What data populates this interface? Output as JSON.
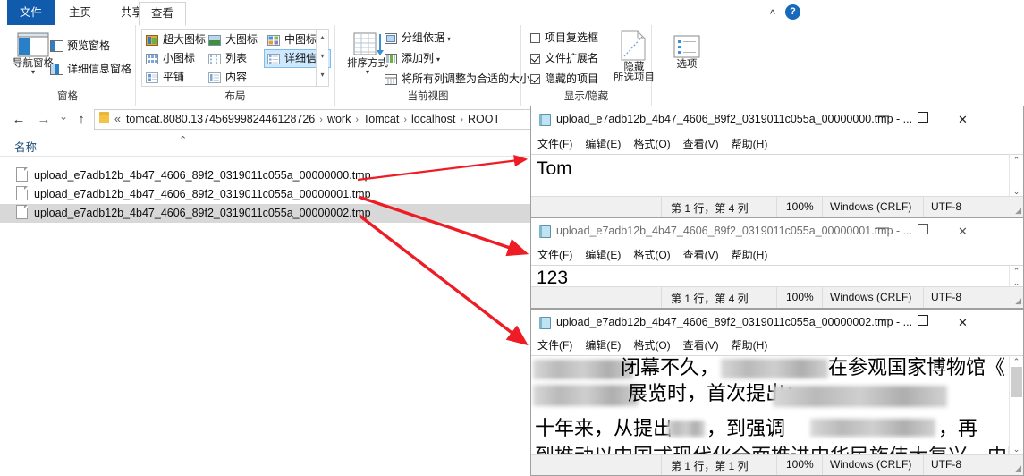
{
  "explorer": {
    "tabs": [
      {
        "label": "文件",
        "active": false,
        "file": true
      },
      {
        "label": "主页",
        "active": false
      },
      {
        "label": "共享",
        "active": false
      },
      {
        "label": "查看",
        "active": true
      }
    ],
    "help_icon": "?",
    "collapse_icon": "chevron-up-icon",
    "ribbon_groups": [
      {
        "name": "窗格",
        "big_button": {
          "label": "导航窗格",
          "caret": "▾"
        },
        "items": [
          {
            "label": "预览窗格"
          },
          {
            "label": "详细信息窗格"
          }
        ]
      },
      {
        "name": "布局",
        "items": [
          {
            "label": "超大图标"
          },
          {
            "label": "大图标"
          },
          {
            "label": "中图标"
          },
          {
            "label": "小图标"
          },
          {
            "label": "列表"
          },
          {
            "label": "详细信息",
            "selected": true
          },
          {
            "label": "平铺"
          },
          {
            "label": "内容"
          }
        ],
        "scroll": [
          "▴",
          "▾",
          "▾"
        ]
      },
      {
        "name": "当前视图",
        "big_button": {
          "label": "排序方式",
          "caret": "▾"
        },
        "items": [
          {
            "label": "分组依据",
            "caret": "▾"
          },
          {
            "label": "添加列",
            "caret": "▾"
          },
          {
            "label": "将所有列调整为合适的大小"
          }
        ]
      },
      {
        "name": "显示/隐藏",
        "checkboxes": [
          {
            "label": "项目复选框",
            "checked": false
          },
          {
            "label": "文件扩展名",
            "checked": true
          },
          {
            "label": "隐藏的项目",
            "checked": true
          }
        ],
        "big_button": {
          "label_line1": "隐藏",
          "label_line2": "所选项目"
        }
      },
      {
        "name": "",
        "big_button": {
          "label": "选项"
        }
      }
    ],
    "nav": {
      "back": "←",
      "forward": "→",
      "recent": "⌄",
      "up": "↑"
    },
    "address": {
      "overflow": "«",
      "crumbs": [
        "tomcat.8080.13745699982446128726",
        "work",
        "Tomcat",
        "localhost",
        "ROOT"
      ],
      "separator": "›"
    },
    "column_header": {
      "name": "名称",
      "sort_arrow": "⌃"
    },
    "files": [
      {
        "name": "upload_e7adb12b_4b47_4606_89f2_0319011c055a_00000000.tmp",
        "selected": false
      },
      {
        "name": "upload_e7adb12b_4b47_4606_89f2_0319011c055a_00000001.tmp",
        "selected": false
      },
      {
        "name": "upload_e7adb12b_4b47_4606_89f2_0319011c055a_00000002.tmp",
        "selected": true
      }
    ]
  },
  "notepads": [
    {
      "title": "upload_e7adb12b_4b47_4606_89f2_0319011c055a_00000000.tmp - ...",
      "active": true,
      "menu": [
        "文件(F)",
        "编辑(E)",
        "格式(O)",
        "查看(V)",
        "帮助(H)"
      ],
      "content": "Tom",
      "controls": {
        "minimize": "—",
        "maximize": "▢",
        "close": "✕"
      },
      "status": {
        "position": "第 1 行，第 4 列",
        "zoom": "100%",
        "eol": "Windows (CRLF)",
        "encoding": "UTF-8"
      }
    },
    {
      "title": "upload_e7adb12b_4b47_4606_89f2_0319011c055a_00000001.tmp - ...",
      "active": false,
      "menu": [
        "文件(F)",
        "编辑(E)",
        "格式(O)",
        "查看(V)",
        "帮助(H)"
      ],
      "content": "123",
      "controls": {
        "minimize": "—",
        "maximize": "▢",
        "close": "✕"
      },
      "status": {
        "position": "第 1 行，第 4 列",
        "zoom": "100%",
        "eol": "Windows (CRLF)",
        "encoding": "UTF-8"
      }
    },
    {
      "title": "upload_e7adb12b_4b47_4606_89f2_0319011c055a_00000002.tmp - ...",
      "active": true,
      "menu": [
        "文件(F)",
        "编辑(E)",
        "格式(O)",
        "查看(V)",
        "帮助(H)"
      ],
      "content_lines": [
        "闭幕不久，",
        "在参观国家博物馆《",
        "展览时，首次提出：",
        "十年来，从提出",
        "，到强调",
        "，再"
      ],
      "controls": {
        "minimize": "—",
        "maximize": "▢",
        "close": "✕"
      },
      "status": {
        "position": "第 1 行，第 1 列",
        "zoom": "100%",
        "eol": "Windows (CRLF)",
        "encoding": "UTF-8"
      }
    }
  ],
  "annotations": {
    "arrow_color": "#ee1c25",
    "arrow_count": 3,
    "description": "red arrows from each file row to its notepad window"
  }
}
